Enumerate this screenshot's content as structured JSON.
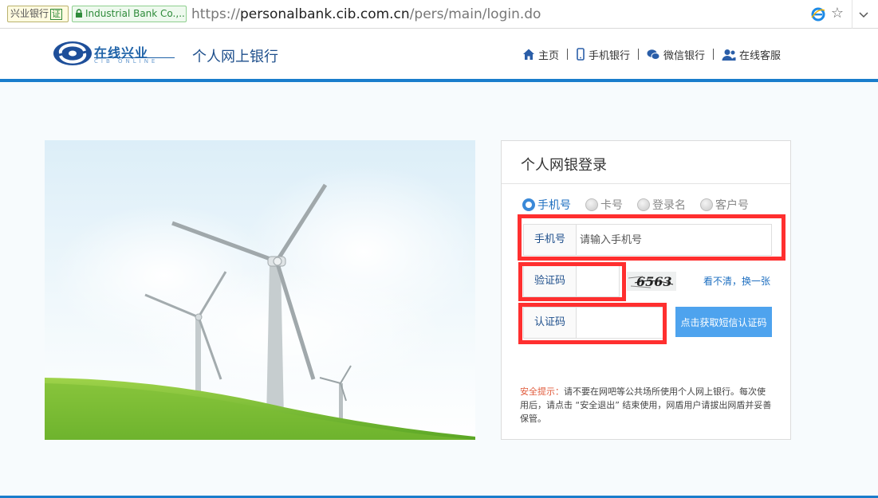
{
  "browser": {
    "site_name_tag": "兴业银行",
    "cert_badge": "证",
    "ev_tag": "Industrial Bank Co.,...",
    "url_scheme": "https://",
    "url_host": "personalbank.cib.com.cn",
    "url_path": "/pers/main/login.do"
  },
  "header": {
    "logo_text": "在线兴业",
    "logo_sub": "CIB ONLINE",
    "title": "个人网上银行",
    "nav": [
      {
        "label": "主页",
        "icon": "home-icon"
      },
      {
        "label": "手机银行",
        "icon": "mobile-icon"
      },
      {
        "label": "微信银行",
        "icon": "wechat-icon"
      },
      {
        "label": "在线客服",
        "icon": "customer-service-icon"
      }
    ]
  },
  "login": {
    "title": "个人网银登录",
    "login_types": [
      {
        "label": "手机号",
        "selected": true
      },
      {
        "label": "卡号",
        "selected": false
      },
      {
        "label": "登录名",
        "selected": false
      },
      {
        "label": "客户号",
        "selected": false
      }
    ],
    "phone_label": "手机号",
    "phone_placeholder": "请输入手机号",
    "phone_value": "",
    "verify_label": "验证码",
    "verify_value": "",
    "captcha_text": "6563",
    "refresh_link": "看不清，换一张",
    "auth_label": "认证码",
    "auth_value": "",
    "sms_button": "点击获取短信认证码",
    "tip_label": "安全提示：",
    "tip_text": "请不要在网吧等公共场所使用个人网上银行。每次使用后，请点击 “安全退出” 结束使用，网盾用户请拔出网盾并妥善保管。"
  },
  "colors": {
    "brand_blue": "#1a7dcc",
    "button_blue": "#4ea3ee",
    "highlight_red": "#ff2f2f",
    "tip_red": "#e05a3b"
  }
}
